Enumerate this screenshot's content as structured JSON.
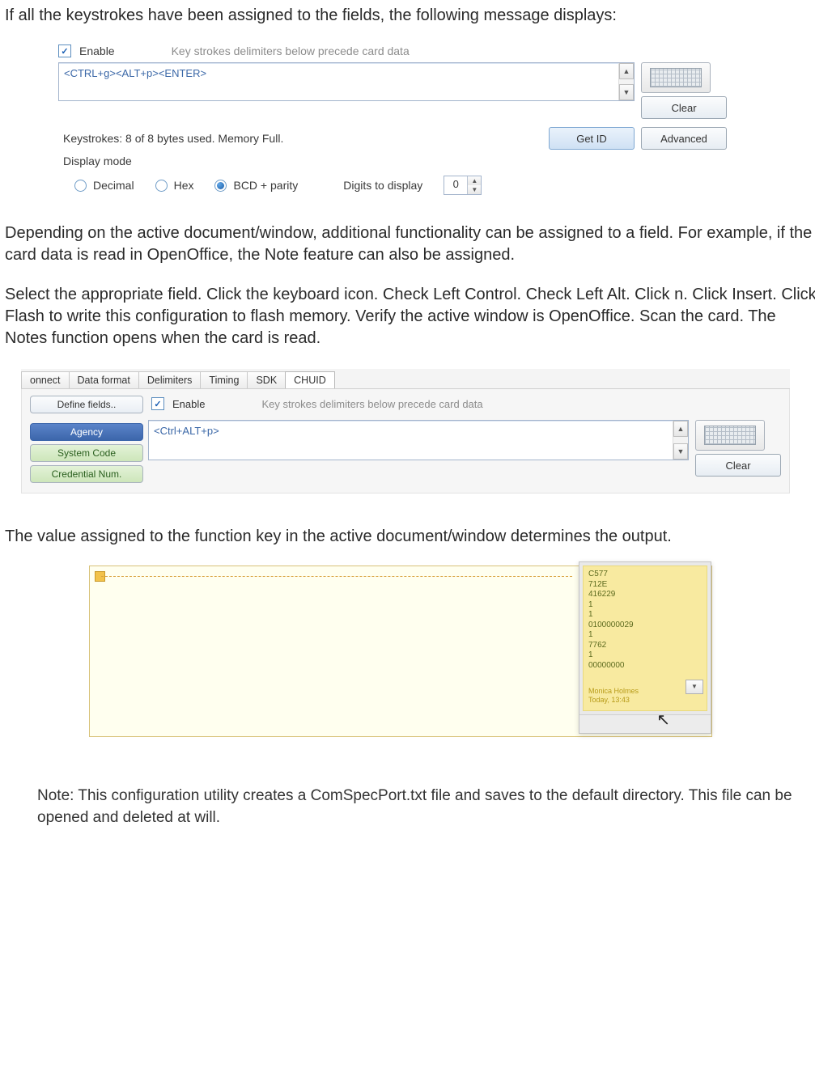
{
  "para1": "If all the keystrokes have been assigned to the fields, the following message displays:",
  "para2": "Depending on the active document/window, additional functionality can be assigned to a field. For example, if the card data is read in OpenOffice, the Note feature can also be assigned.",
  "para3": "Select the appropriate field. Click the keyboard icon. Check Left Control. Check Left Alt. Click n. Click Insert. Click Flash to write this configuration to flash memory. Verify the active window is OpenOffice. Scan the card. The Notes function opens when the card is read.",
  "para4": "The value assigned to the function key in the active document/window determines the output.",
  "note": "Note: This configuration utility creates a ComSpecPort.txt file and saves to the default directory. This file can be opened and deleted at will.",
  "shot1": {
    "enable_label": "Enable",
    "delimiter_hint": "Key strokes delimiters below precede card data",
    "keystrokes_value": "<CTRL+g><ALT+p><ENTER>",
    "clear_label": "Clear",
    "status": "Keystrokes: 8 of 8 bytes used. Memory Full.",
    "get_id_label": "Get ID",
    "advanced_label": "Advanced",
    "display_mode_label": "Display mode",
    "radios": {
      "decimal": "Decimal",
      "hex": "Hex",
      "bcd": "BCD + parity"
    },
    "digits_label": "Digits to display",
    "digits_value": "0"
  },
  "shot2": {
    "tabs": [
      "onnect",
      "Data format",
      "Delimiters",
      "Timing",
      "SDK",
      "CHUID"
    ],
    "active_tab_index": 5,
    "define_fields": "Define fields..",
    "field_buttons": [
      "Agency",
      "System Code",
      "Credential Num."
    ],
    "enable_label": "Enable",
    "delimiter_hint": "Key strokes delimiters below precede card data",
    "keystrokes_value": "<Ctrl+ALT+p>",
    "clear_label": "Clear"
  },
  "shot3": {
    "lines": [
      "C577",
      "712E",
      "416229",
      "1",
      "1",
      "0100000029",
      "1",
      "7762",
      "1",
      "00000000"
    ],
    "meta_name": "Monica Holmes",
    "meta_time": "Today, 13:43"
  }
}
